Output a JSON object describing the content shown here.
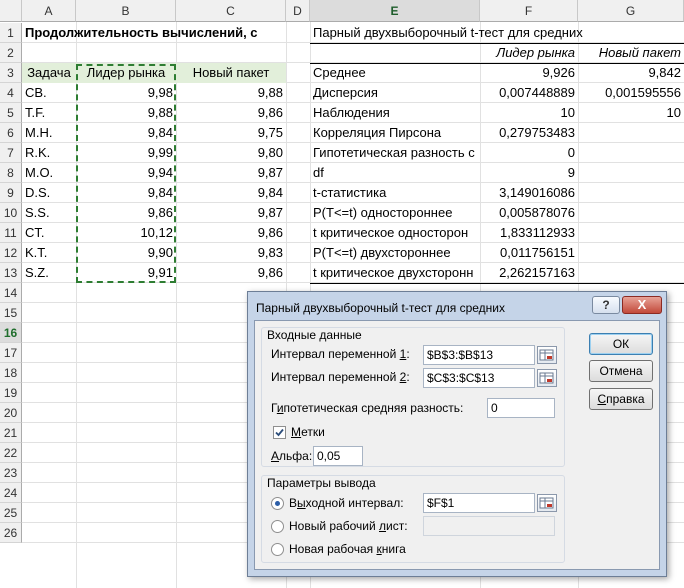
{
  "columns": [
    "A",
    "B",
    "C",
    "D",
    "E",
    "F",
    "G"
  ],
  "rows": [
    "1",
    "2",
    "3",
    "4",
    "5",
    "6",
    "7",
    "8",
    "9",
    "10",
    "11",
    "12",
    "13",
    "14",
    "15",
    "16",
    "17",
    "18",
    "19",
    "20",
    "21",
    "22",
    "23",
    "24",
    "25",
    "26"
  ],
  "left_table": {
    "title": "Продолжительность вычислений, с",
    "headers": [
      "Задача",
      "Лидер рынка",
      "Новый пакет"
    ],
    "rows": [
      [
        "CB.",
        "9,98",
        "9,88"
      ],
      [
        "T.F.",
        "9,88",
        "9,86"
      ],
      [
        "M.H.",
        "9,84",
        "9,75"
      ],
      [
        "R.K.",
        "9,99",
        "9,80"
      ],
      [
        "M.O.",
        "9,94",
        "9,87"
      ],
      [
        "D.S.",
        "9,84",
        "9,84"
      ],
      [
        "S.S.",
        "9,86",
        "9,87"
      ],
      [
        "CT.",
        "10,12",
        "9,86"
      ],
      [
        "K.T.",
        "9,90",
        "9,83"
      ],
      [
        "S.Z.",
        "9,91",
        "9,86"
      ]
    ]
  },
  "result_table": {
    "title": "Парный двухвыборочный t-тест для средних",
    "headers": [
      "Лидер рынка",
      "Новый пакет"
    ],
    "rows": [
      [
        "Среднее",
        "9,926",
        "9,842"
      ],
      [
        "Дисперсия",
        "0,007448889",
        "0,001595556"
      ],
      [
        "Наблюдения",
        "10",
        "10"
      ],
      [
        "Корреляция Пирсона",
        "0,279753483",
        ""
      ],
      [
        "Гипотетическая разность с",
        "0",
        ""
      ],
      [
        "df",
        "9",
        ""
      ],
      [
        "t-статистика",
        "3,149016086",
        ""
      ],
      [
        "P(T<=t) одностороннее",
        "0,005878076",
        ""
      ],
      [
        "t критическое односторон",
        "1,833112933",
        ""
      ],
      [
        "P(T<=t) двухстороннее",
        "0,011756151",
        ""
      ],
      [
        "t критическое двухсторонн",
        "2,262157163",
        ""
      ]
    ]
  },
  "dialog": {
    "title": "Парный двухвыборочный t-тест для средних",
    "help": "?",
    "close": "X",
    "input_group": "Входные данные",
    "var1_label_pre": "Интервал переменной ",
    "var1_label_key": "1",
    "var1_label_post": ":",
    "var1_value": "$B$3:$B$13",
    "var2_label_pre": "Интервал переменной ",
    "var2_label_key": "2",
    "var2_label_post": ":",
    "var2_value": "$C$3:$C$13",
    "hyp_label_pre": "Г",
    "hyp_label_key": "и",
    "hyp_label_post": "потетическая средняя разность:",
    "hyp_value": "0",
    "labels_pre": "",
    "labels_key": "М",
    "labels_post": "етки",
    "alpha_label_pre": "",
    "alpha_label_key": "А",
    "alpha_label_post": "льфа:",
    "alpha_value": "0,05",
    "output_group": "Параметры вывода",
    "out_range_pre": "В",
    "out_range_key": "ы",
    "out_range_post": "ходной интервал:",
    "out_range_value": "$F$1",
    "new_sheet_pre": "Новый рабочий ",
    "new_sheet_key": "л",
    "new_sheet_post": "ист:",
    "new_sheet_value": "",
    "new_book_pre": "Новая рабочая ",
    "new_book_key": "к",
    "new_book_post": "нига",
    "ok": "ОК",
    "cancel": "Отмена",
    "help_btn_pre": "",
    "help_btn_key": "С",
    "help_btn_post": "правка"
  },
  "colors": {
    "header_fill": "#e2efda",
    "selected_header": "#dcdcdc",
    "marquee": "#2e7d32",
    "dialog_frame": "#c5d4e8"
  },
  "icons": {
    "range_select": "range-select-icon",
    "checkbox": "checkmark-icon"
  }
}
